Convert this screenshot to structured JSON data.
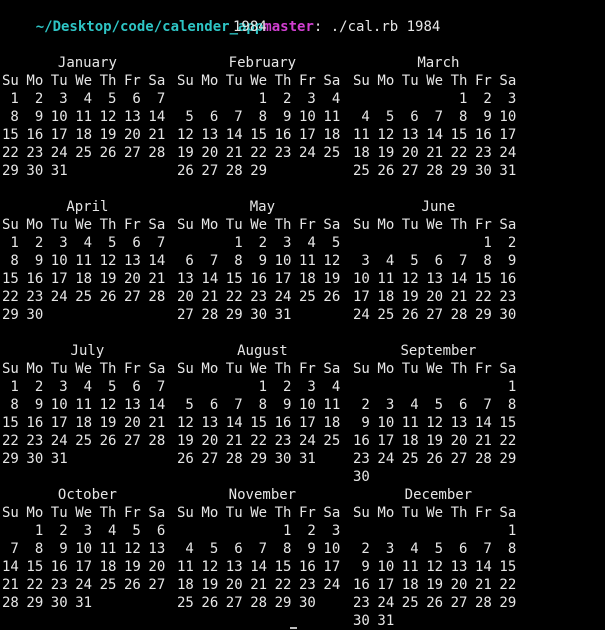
{
  "prompt": {
    "path": "~/Desktop/code/calender_app",
    "branch": "master",
    "separator": ":",
    "command": " ./cal.rb 1984"
  },
  "year_heading": "1984",
  "weekday_headers": [
    "Su",
    "Mo",
    "Tu",
    "We",
    "Th",
    "Fr",
    "Sa"
  ],
  "months": [
    {
      "name": "January",
      "first_weekday": 0,
      "days": 31
    },
    {
      "name": "February",
      "first_weekday": 3,
      "days": 29
    },
    {
      "name": "March",
      "first_weekday": 4,
      "days": 31
    },
    {
      "name": "April",
      "first_weekday": 0,
      "days": 30
    },
    {
      "name": "May",
      "first_weekday": 2,
      "days": 31
    },
    {
      "name": "June",
      "first_weekday": 5,
      "days": 30
    },
    {
      "name": "July",
      "first_weekday": 0,
      "days": 31
    },
    {
      "name": "August",
      "first_weekday": 3,
      "days": 31
    },
    {
      "name": "September",
      "first_weekday": 6,
      "days": 30
    },
    {
      "name": "October",
      "first_weekday": 1,
      "days": 31
    },
    {
      "name": "November",
      "first_weekday": 4,
      "days": 30
    },
    {
      "name": "December",
      "first_weekday": 6,
      "days": 31
    }
  ],
  "colors": {
    "background": "#000000",
    "text": "#e6e6e6",
    "path": "#2ec5c5",
    "branch": "#d23fd2"
  }
}
